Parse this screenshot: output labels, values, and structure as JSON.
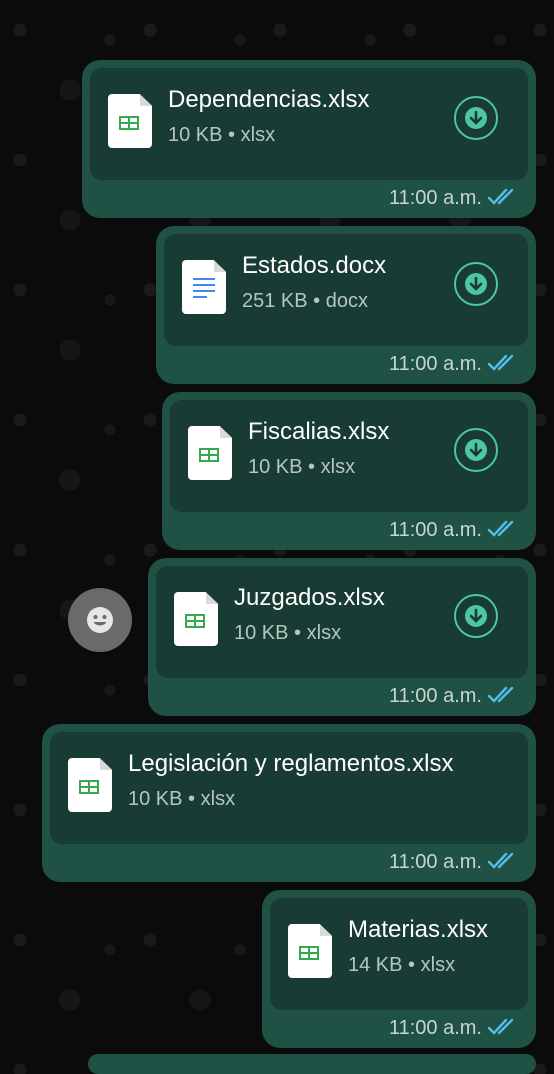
{
  "messages": [
    {
      "file_name": "Dependencias.xlsx",
      "size": "10 KB",
      "ext": "xlsx",
      "time": "11:00 a.m.",
      "icon": "spreadsheet-icon",
      "downloadable": true
    },
    {
      "file_name": "Estados.docx",
      "size": "251 KB",
      "ext": "docx",
      "time": "11:00 a.m.",
      "icon": "document-icon",
      "downloadable": true
    },
    {
      "file_name": "Fiscalias.xlsx",
      "size": "10 KB",
      "ext": "xlsx",
      "time": "11:00 a.m.",
      "icon": "spreadsheet-icon",
      "downloadable": true
    },
    {
      "file_name": "Juzgados.xlsx",
      "size": "10 KB",
      "ext": "xlsx",
      "time": "11:00 a.m.",
      "icon": "spreadsheet-icon",
      "downloadable": true
    },
    {
      "file_name": "Legislación y reglamentos.xlsx",
      "size": "10 KB",
      "ext": "xlsx",
      "time": "11:00 a.m.",
      "icon": "spreadsheet-icon",
      "downloadable": false
    },
    {
      "file_name": "Materias.xlsx",
      "size": "14 KB",
      "ext": "xlsx",
      "time": "11:00 a.m.",
      "icon": "spreadsheet-icon",
      "downloadable": false
    }
  ],
  "meta_separator": "•",
  "read_status": "read-double-check",
  "reaction_button": {
    "icon": "emoji-smile-icon"
  },
  "colors": {
    "bubble": "#1f5144",
    "card": "#183b33",
    "accent": "#4cc7a0",
    "check": "#53bdeb",
    "sheet": "#36a852",
    "doc": "#4285f4"
  }
}
